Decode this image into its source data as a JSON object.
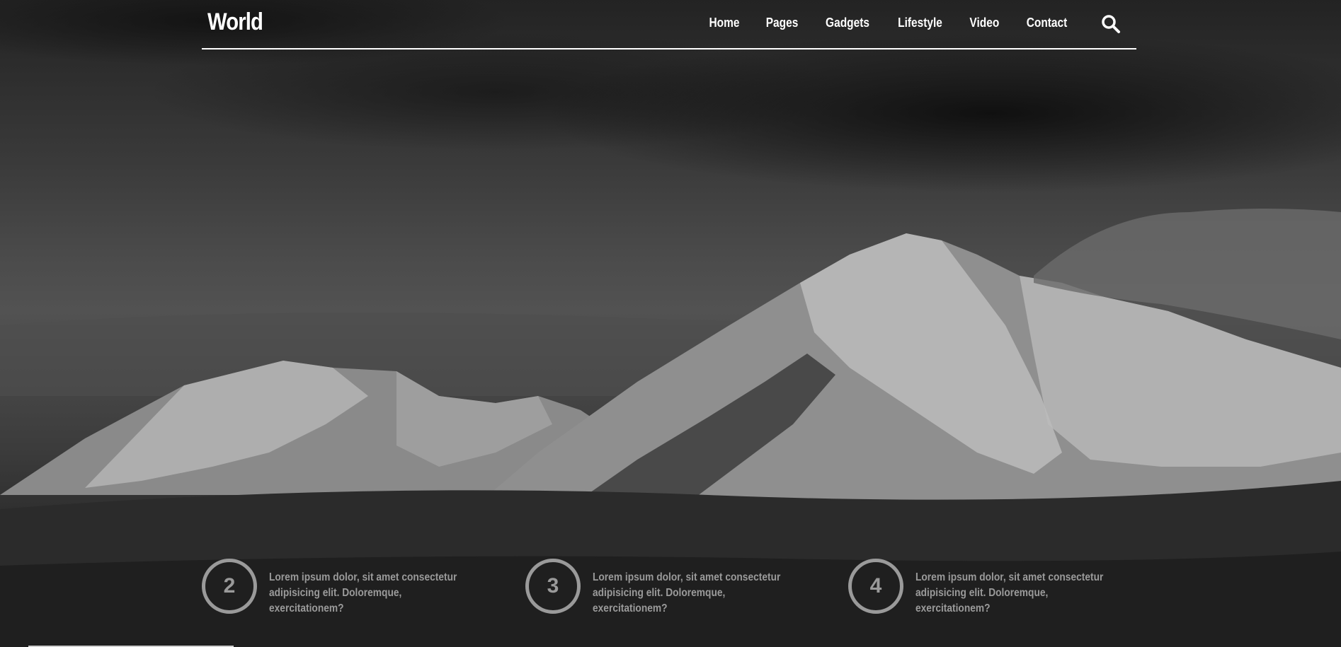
{
  "brand": {
    "logo_text": "World"
  },
  "nav": {
    "items": [
      {
        "label": "Home"
      },
      {
        "label": "Pages"
      },
      {
        "label": "Gadgets"
      },
      {
        "label": "Lifestyle"
      },
      {
        "label": "Video"
      },
      {
        "label": "Contact"
      }
    ],
    "search_icon": "search-icon"
  },
  "features": [
    {
      "number": "2",
      "text": "Lorem ipsum dolor, sit amet consectetur adipisicing elit. Doloremque, exercitationem?"
    },
    {
      "number": "3",
      "text": "Lorem ipsum dolor, sit amet consectetur adipisicing elit. Doloremque, exercitationem?"
    },
    {
      "number": "4",
      "text": "Lorem ipsum dolor, sit amet consectetur adipisicing elit. Doloremque, exercitationem?"
    }
  ],
  "colors": {
    "text_primary": "#ffffff",
    "text_muted": "#9a9a9a"
  }
}
